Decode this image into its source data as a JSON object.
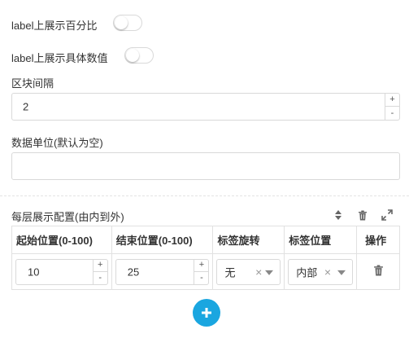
{
  "fields": {
    "show_percent_label": "label上展示百分比",
    "show_value_label": "label上展示具体数值",
    "block_gap_label": "区块间隔",
    "block_gap_value": "2",
    "unit_label": "数据单位(默认为空)",
    "unit_value": ""
  },
  "toggles": {
    "show_percent": false,
    "show_value": false
  },
  "stepper": {
    "up": "+",
    "down": "-"
  },
  "layers": {
    "title": "每层展示配置(由内到外)",
    "icons": [
      "sort-icon",
      "trash-icon",
      "expand-icon"
    ],
    "columns": [
      "起始位置(0-100)",
      "结束位置(0-100)",
      "标签旋转",
      "标签位置",
      "操作"
    ],
    "rows": [
      {
        "start": "10",
        "end": "25",
        "rotation": "无",
        "position": "内部"
      }
    ],
    "clear_symbol": "×",
    "add_icon": "plus-icon"
  },
  "colors": {
    "accent": "#1aa6e0",
    "border": "#d9d9d9"
  }
}
